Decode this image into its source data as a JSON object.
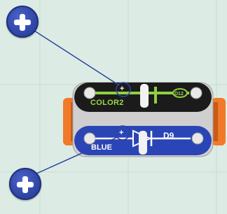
{
  "components": {
    "upper_led": {
      "name_label": "COLOR2",
      "id_label": "D12",
      "terminal_sign": "+"
    },
    "lower_led": {
      "name_label": "BLUE",
      "id_label": "D9",
      "terminal_sign": "+"
    }
  },
  "icons": [
    "plus-badge-icon",
    "plus-badge-icon"
  ],
  "colors": {
    "background": "#dcece4",
    "grid": "#c9ddd2",
    "upper_body": "#1b1b1b",
    "lower_body": "#2a45b5",
    "trace_green": "#8fd13f",
    "connector_orange": "#f07a2a",
    "badge_blue": "#2c43a2"
  }
}
